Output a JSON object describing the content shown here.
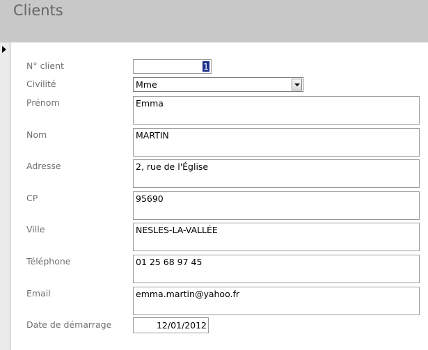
{
  "header": {
    "title": "Clients"
  },
  "fields": {
    "client_number": {
      "label": "N° client",
      "value": "1"
    },
    "civility": {
      "label": "Civilité",
      "value": "Mme"
    },
    "first_name": {
      "label": "Prénom",
      "value": "Emma"
    },
    "last_name": {
      "label": "Nom",
      "value": "MARTIN"
    },
    "address": {
      "label": "Adresse",
      "value": "2, rue de l'Église"
    },
    "postal_code": {
      "label": "CP",
      "value": "95690"
    },
    "city": {
      "label": "Ville",
      "value": "NESLES-LA-VALLÉE"
    },
    "phone": {
      "label": "Téléphone",
      "value": "01 25 68 97 45"
    },
    "email": {
      "label": "Email",
      "value": "emma.martin@yahoo.fr"
    },
    "start_date": {
      "label": "Date de démarrage",
      "value": "12/01/2012"
    }
  },
  "icons": {
    "record_selector": "play-arrow-icon",
    "dropdown": "chevron-down-icon"
  }
}
